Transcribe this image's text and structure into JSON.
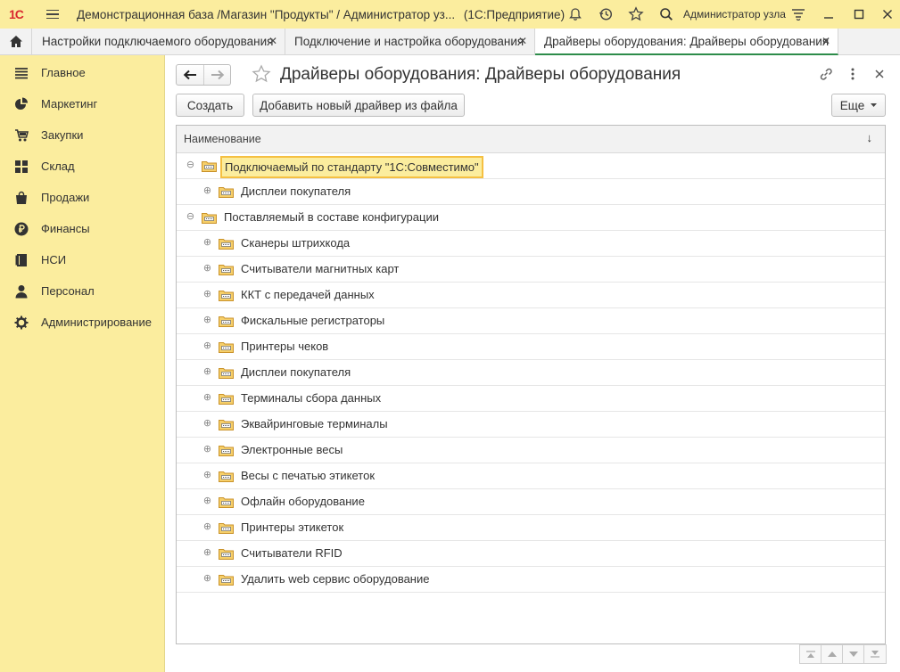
{
  "app": {
    "logo_text": "1С",
    "title": "Демонстрационная база /Магазин \"Продукты\" / Администратор уз...",
    "platform": "(1С:Предприятие)",
    "user": "Администратор узла"
  },
  "tabs": [
    {
      "label": "Настройки подключаемого оборудования",
      "close": "✕"
    },
    {
      "label": "Подключение и настройка оборудования",
      "close": "✕"
    },
    {
      "label": "Драйверы оборудования: Драйверы оборудования",
      "close": "✕"
    }
  ],
  "sidebar": {
    "items": [
      {
        "label": "Главное",
        "icon": "list-icon"
      },
      {
        "label": "Маркетинг",
        "icon": "pie-chart-icon"
      },
      {
        "label": "Закупки",
        "icon": "cart-icon"
      },
      {
        "label": "Склад",
        "icon": "warehouse-icon"
      },
      {
        "label": "Продажи",
        "icon": "bag-icon"
      },
      {
        "label": "Финансы",
        "icon": "ruble-icon"
      },
      {
        "label": "НСИ",
        "icon": "book-icon"
      },
      {
        "label": "Персонал",
        "icon": "person-icon"
      },
      {
        "label": "Администрирование",
        "icon": "gear-icon"
      }
    ]
  },
  "form": {
    "title": "Драйверы оборудования: Драйверы оборудования",
    "create_label": "Создать",
    "add_from_file_label": "Добавить новый драйвер из файла",
    "more_label": "Еще",
    "column_header": "Наименование",
    "sort_arrow": "↓"
  },
  "tree": [
    {
      "level": 0,
      "expander": "⊖",
      "label": "Подключаемый по стандарту \"1С:Совместимо\"",
      "selected": true
    },
    {
      "level": 1,
      "expander": "⊕",
      "label": "Дисплеи покупателя"
    },
    {
      "level": 0,
      "expander": "⊖",
      "label": "Поставляемый в составе конфигурации"
    },
    {
      "level": 1,
      "expander": "⊕",
      "label": "Сканеры штрихкода"
    },
    {
      "level": 1,
      "expander": "⊕",
      "label": "Считыватели магнитных карт"
    },
    {
      "level": 1,
      "expander": "⊕",
      "label": "ККТ с передачей данных"
    },
    {
      "level": 1,
      "expander": "⊕",
      "label": "Фискальные регистраторы"
    },
    {
      "level": 1,
      "expander": "⊕",
      "label": "Принтеры чеков"
    },
    {
      "level": 1,
      "expander": "⊕",
      "label": "Дисплеи покупателя"
    },
    {
      "level": 1,
      "expander": "⊕",
      "label": "Терминалы сбора данных"
    },
    {
      "level": 1,
      "expander": "⊕",
      "label": "Эквайринговые терминалы"
    },
    {
      "level": 1,
      "expander": "⊕",
      "label": "Электронные весы"
    },
    {
      "level": 1,
      "expander": "⊕",
      "label": "Весы с печатью этикеток"
    },
    {
      "level": 1,
      "expander": "⊕",
      "label": "Офлайн оборудование"
    },
    {
      "level": 1,
      "expander": "⊕",
      "label": "Принтеры этикеток"
    },
    {
      "level": 1,
      "expander": "⊕",
      "label": "Считыватели RFID"
    },
    {
      "level": 1,
      "expander": "⊕",
      "label": "Удалить web сервис оборудование"
    }
  ],
  "colors": {
    "brand_yellow": "#fbed9e",
    "selection_border": "#f5c042",
    "active_tab_underline": "#2d8c4a",
    "logo_red": "#d9282f",
    "folder": "#e8b84a"
  }
}
